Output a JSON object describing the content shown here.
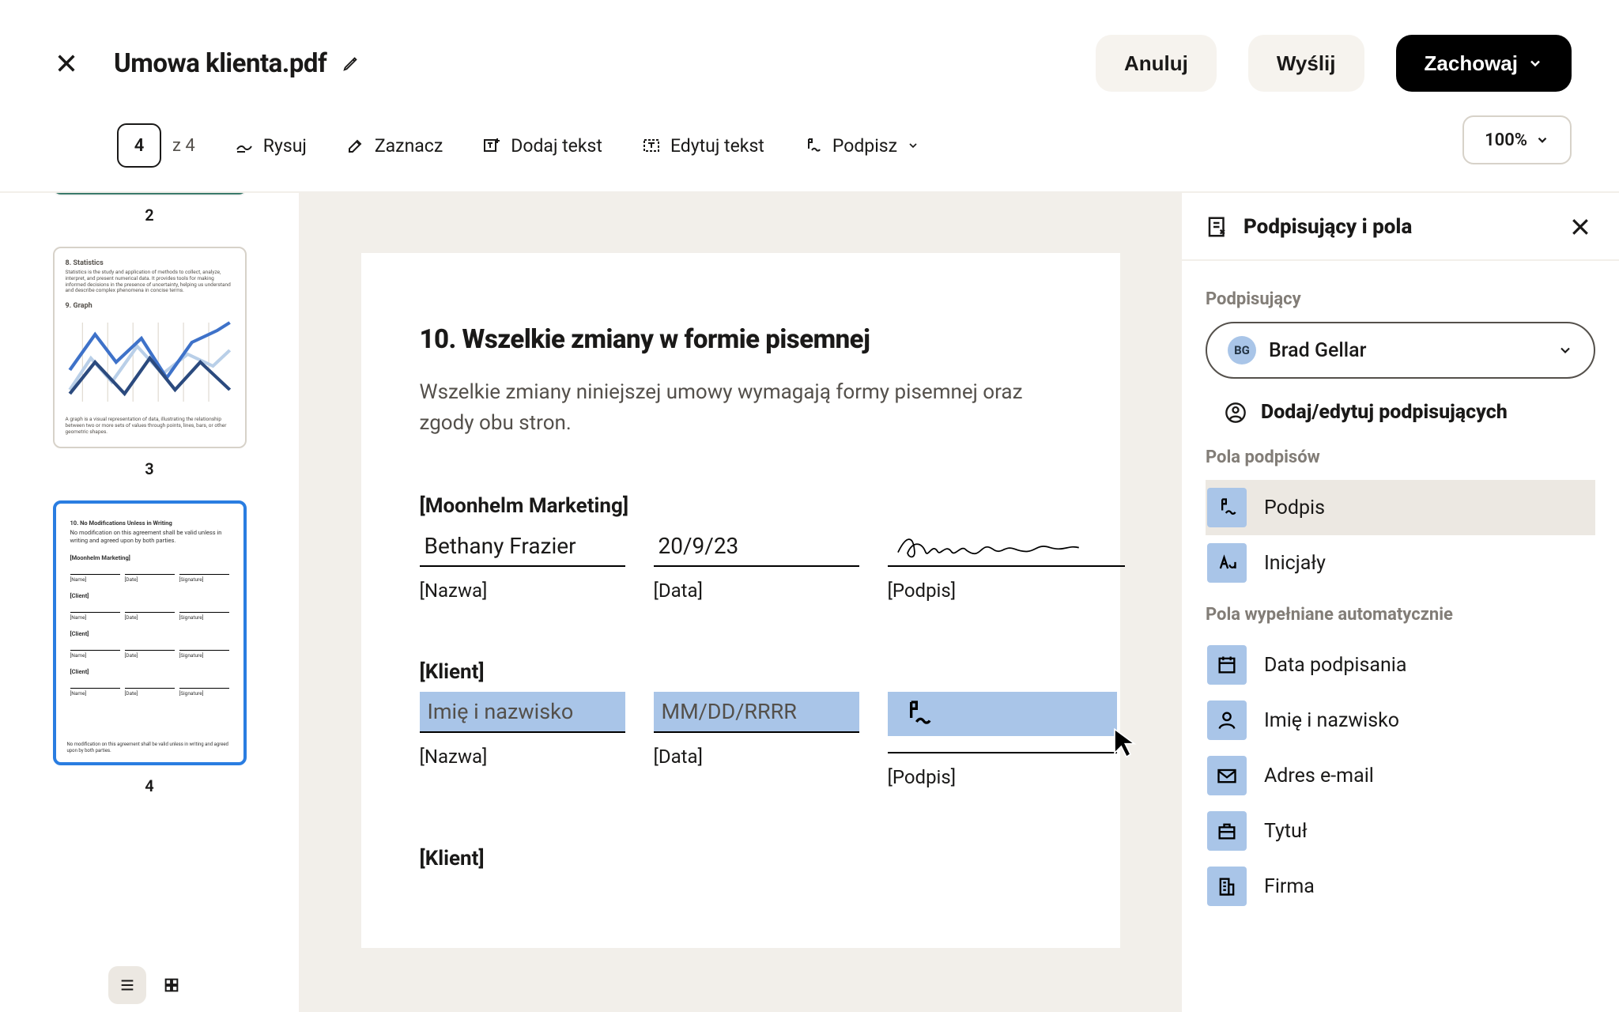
{
  "header": {
    "title": "Umowa klienta.pdf",
    "cancel": "Anuluj",
    "send": "Wyślij",
    "save": "Zachowaj"
  },
  "toolbar": {
    "page_current": "4",
    "page_of_prefix": "z",
    "page_total": "4",
    "draw": "Rysuj",
    "highlight": "Zaznacz",
    "add_text": "Dodaj tekst",
    "edit_text": "Edytuj tekst",
    "sign": "Podpisz",
    "zoom": "100%"
  },
  "thumbs": {
    "p2": "2",
    "p3": "3",
    "p4": "4",
    "p3_head1": "8. Statistics",
    "p3_body1": "Statistics is the study and application of methods to collect, analyze, interpret, and present numerical data. It provides tools for making informed decisions in the presence of uncertainty, helping us understand and describe complex phenomena in concise terms.",
    "p3_head2": "9. Graph",
    "p3_caption": "A graph is a visual representation of data, illustrating the relationship between two or more sets of values through points, lines, bars, or other geometric shapes.",
    "p4_head": "10. No Modifications Unless in Writing",
    "p4_body": "No modification on this agreement shall be valid unless in writing and agreed upon by both parties.",
    "p4_party1": "[Moonhelm Marketing]",
    "p4_party2": "[Client]",
    "p4_name": "[Name]",
    "p4_date": "[Date]",
    "p4_sig": "[Signature]",
    "p4_foot": "No modification on this agreement shall be valid unless in writing and agreed upon by both parties."
  },
  "doc": {
    "heading": "10. Wszelkie zmiany w formie pisemnej",
    "body": "Wszelkie zmiany niniejszej umowy wymagają formy pisemnej oraz zgody obu stron.",
    "party1": "[Moonhelm Marketing]",
    "name_value": "Bethany Frazier",
    "date_value": "20/9/23",
    "name_label": "[Nazwa]",
    "date_label": "[Data]",
    "sig_label": "[Podpis]",
    "party2": "[Klient]",
    "name_placeholder": "Imię i nazwisko",
    "date_placeholder": "MM/DD/RRRR",
    "party3": "[Klient]"
  },
  "side": {
    "title": "Podpisujący i pola",
    "signer_label": "Podpisujący",
    "signer_initials": "BG",
    "signer_name": "Brad Gellar",
    "add_signers": "Dodaj/edytuj podpisujących",
    "sig_fields_label": "Pola podpisów",
    "field_signature": "Podpis",
    "field_initials": "Inicjały",
    "autofill_label": "Pola wypełniane automatycznie",
    "field_date_signed": "Data podpisania",
    "field_name": "Imię i nazwisko",
    "field_email": "Adres e-mail",
    "field_title": "Tytuł",
    "field_company": "Firma"
  }
}
